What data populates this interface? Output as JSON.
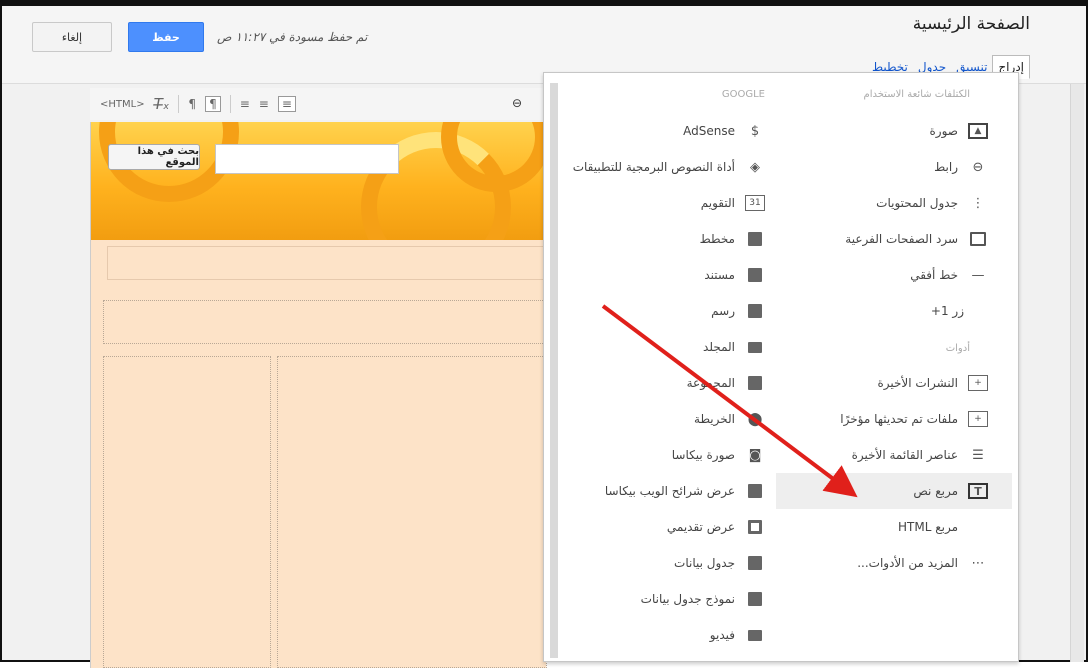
{
  "toolbar_top": {
    "cancel_label": "إلغاء",
    "save_label": "حفظ",
    "draft_status": "تم حفظ مسودة في ١١:٢٧ ص"
  },
  "page": {
    "title": "الصفحة الرئيسية"
  },
  "menus": [
    {
      "label": "إدراج"
    },
    {
      "label": "تنسيق"
    },
    {
      "label": "جدول"
    },
    {
      "label": "تخطيط"
    }
  ],
  "editor_toolbar": {
    "html_label": "<HTML>"
  },
  "site": {
    "search_button": "بحث في هذا الموقع"
  },
  "dropdown": {
    "right_header": "الكتلفات شائعة الاستخدام",
    "left_header": "GOOGLE",
    "gadgets_header": "أدوات",
    "right_items": [
      {
        "label": "صورة",
        "icon": "image-icon"
      },
      {
        "label": "رابط",
        "icon": "link-icon"
      },
      {
        "label": "جدول المحتويات",
        "icon": "toc-icon"
      },
      {
        "label": "سرد الصفحات الفرعية",
        "icon": "subpages-icon"
      },
      {
        "label": "خط أفقي",
        "icon": "horizontal-line-icon"
      },
      {
        "label": "زر 1+",
        "icon": ""
      }
    ],
    "gadget_items": [
      {
        "label": "النشرات الأخيرة",
        "icon": "recent-posts-icon"
      },
      {
        "label": "ملفات تم تحديثها مؤخرًا",
        "icon": "recent-files-icon"
      },
      {
        "label": "عناصر القائمة الأخيرة",
        "icon": "recent-list-icon"
      },
      {
        "label": "مربع نص",
        "icon": "text-box-icon"
      },
      {
        "label": "مربع HTML",
        "icon": ""
      },
      {
        "label": "المزيد من الأدوات...",
        "icon": "more-icon"
      }
    ],
    "left_items": [
      {
        "label": "AdSense",
        "icon": "dollar-icon"
      },
      {
        "label": "أداة النصوص البرمجية للتطبيقات",
        "icon": "apps-script-icon"
      },
      {
        "label": "التقويم",
        "icon": "calendar-icon"
      },
      {
        "label": "مخطط",
        "icon": "chart-icon"
      },
      {
        "label": "مستند",
        "icon": "document-icon"
      },
      {
        "label": "رسم",
        "icon": "drawing-icon"
      },
      {
        "label": "المجلد",
        "icon": "folder-icon"
      },
      {
        "label": "المجموعة",
        "icon": "group-icon"
      },
      {
        "label": "الخريطة",
        "icon": "map-pin-icon"
      },
      {
        "label": "صورة بيكاسا",
        "icon": "camera-icon"
      },
      {
        "label": "عرض شرائح الويب بيكاسا",
        "icon": "slideshow-icon"
      },
      {
        "label": "عرض تقديمي",
        "icon": "presentation-icon"
      },
      {
        "label": "جدول بيانات",
        "icon": "spreadsheet-icon"
      },
      {
        "label": "نموذج جدول بيانات",
        "icon": "form-icon"
      },
      {
        "label": "فيديو",
        "icon": "video-icon"
      }
    ]
  },
  "colors": {
    "accent": "#4d90fe",
    "arrow": "#e0201b",
    "banner": "#ffb21e"
  }
}
